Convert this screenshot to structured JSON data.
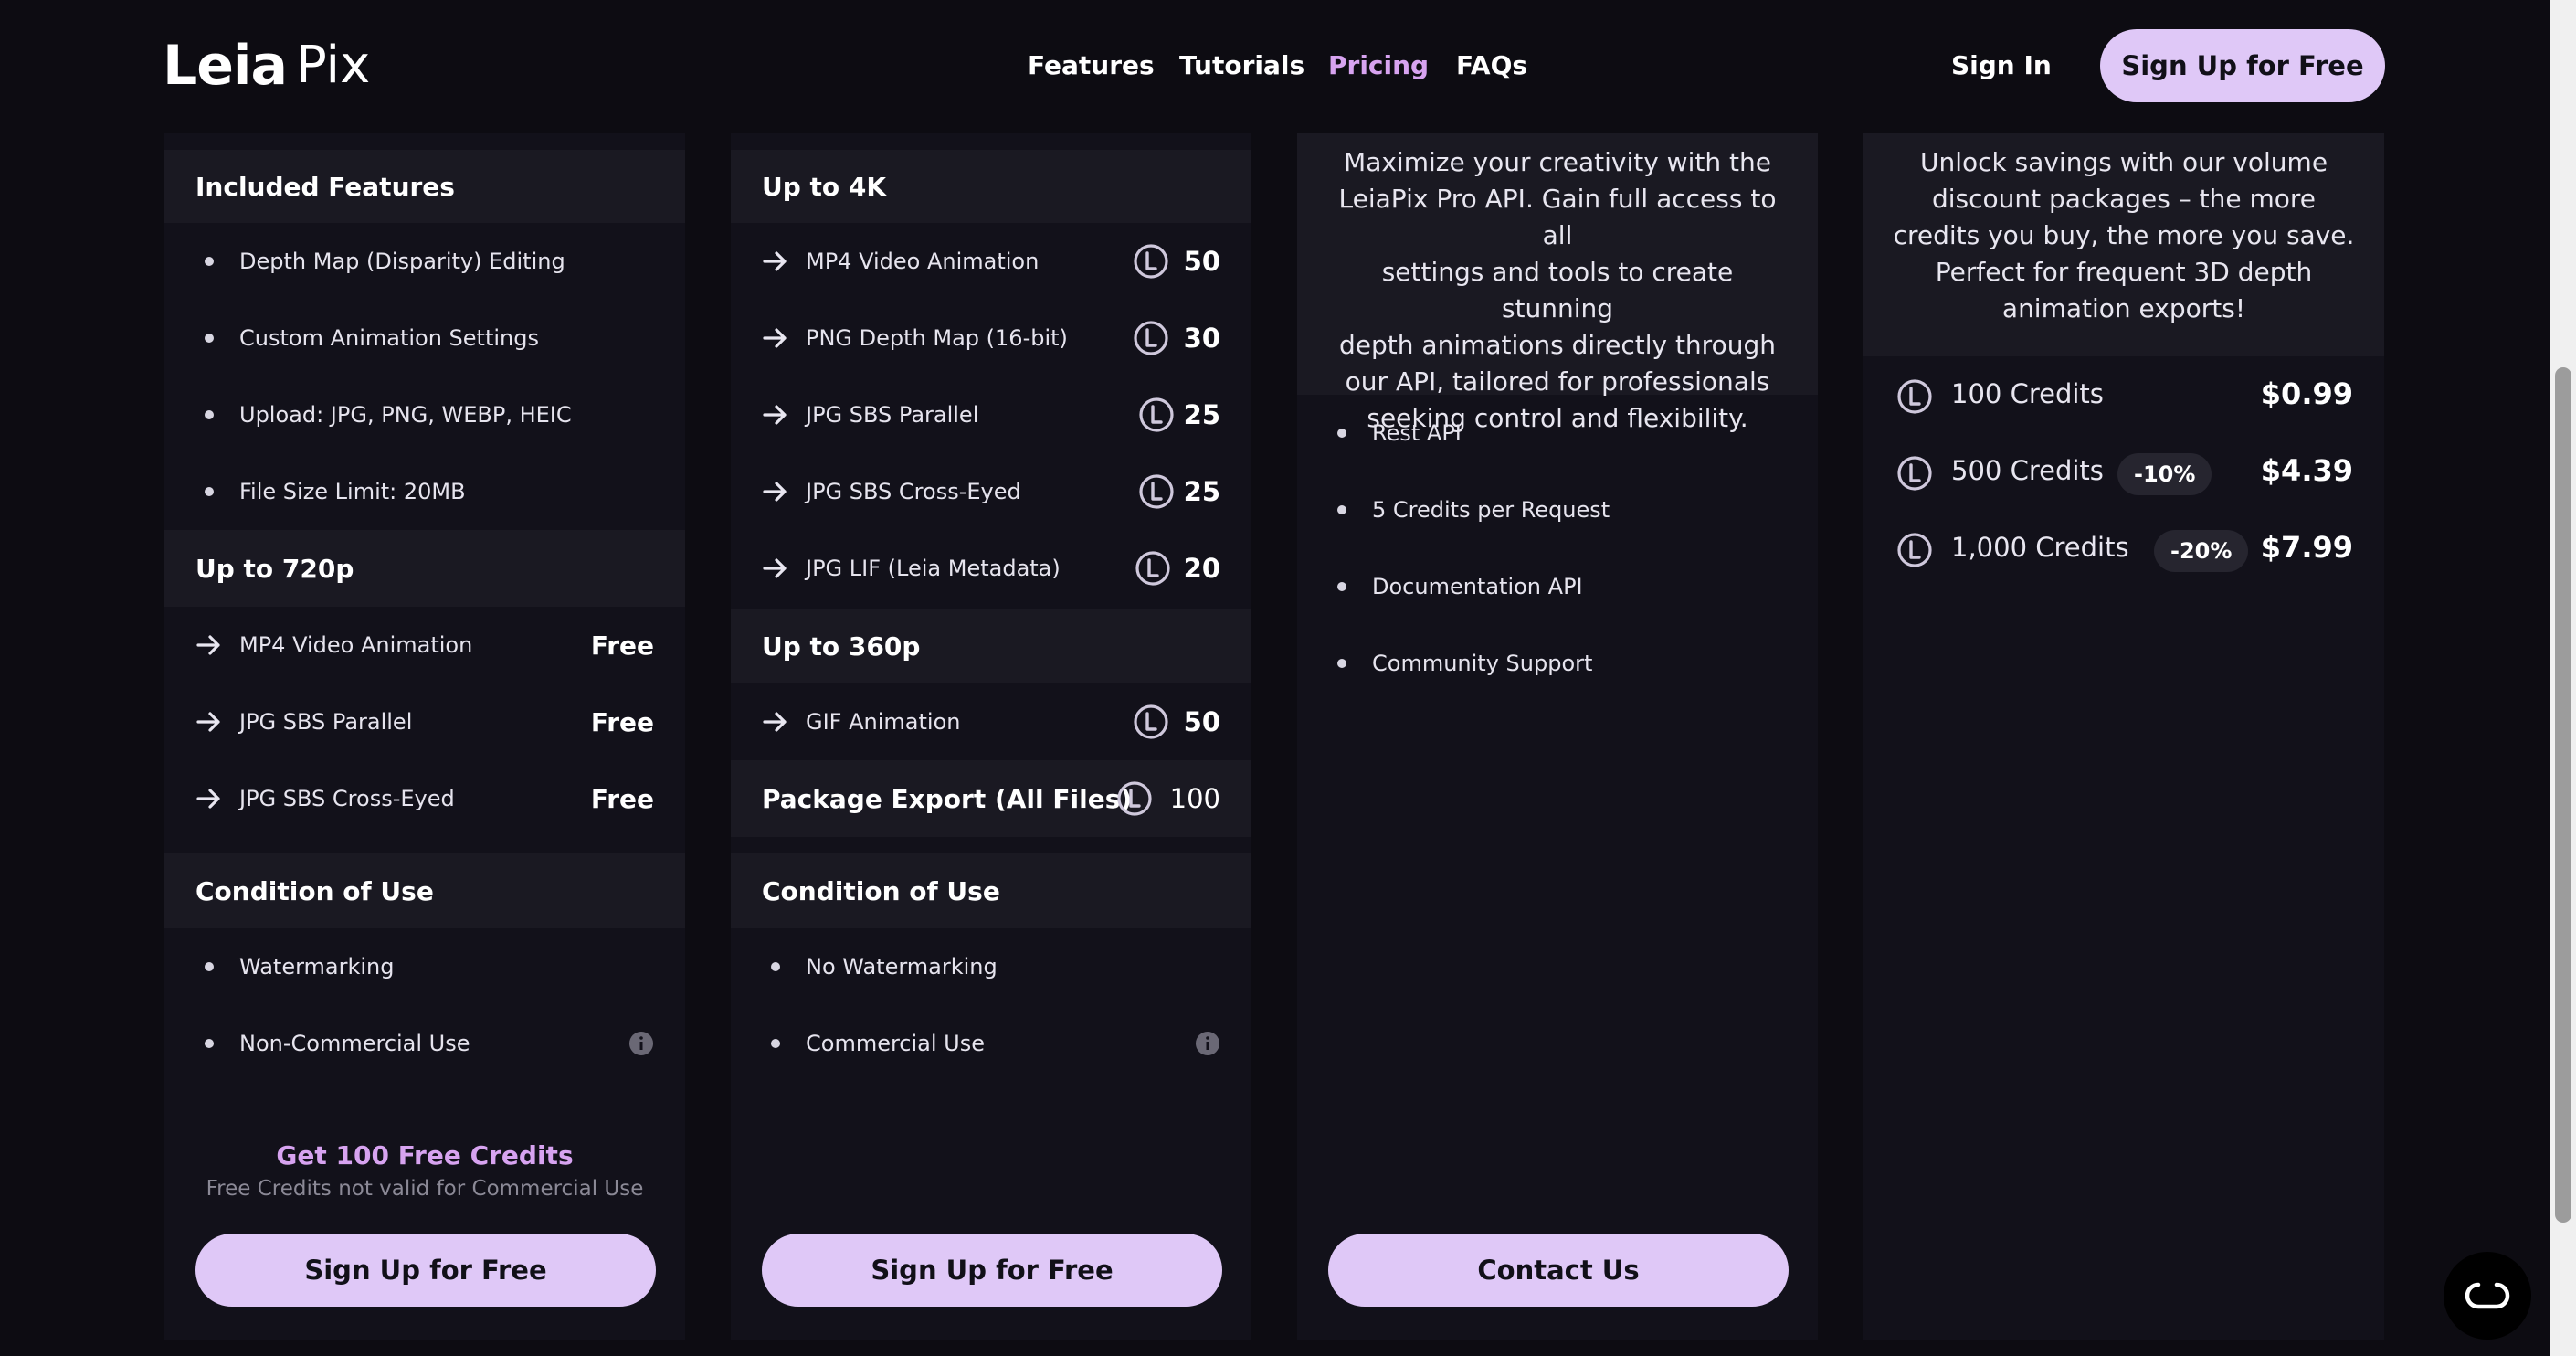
{
  "header": {
    "logo_leia": "Leia",
    "logo_pix": "Pix",
    "nav": [
      "Features",
      "Tutorials",
      "Pricing",
      "FAQs"
    ],
    "active_nav": "Pricing",
    "sign_in": "Sign In",
    "cta": "Sign Up for Free"
  },
  "free_card": {
    "included_title": "Included Features",
    "included": [
      "Depth Map (Disparity) Editing",
      "Custom Animation Settings",
      "Upload: JPG, PNG, WEBP, HEIC",
      "File Size Limit: 20MB"
    ],
    "res_title": "Up to 720p",
    "exports": [
      {
        "label": "MP4 Video Animation",
        "value": "Free"
      },
      {
        "label": "JPG SBS Parallel",
        "value": "Free"
      },
      {
        "label": "JPG SBS Cross-Eyed",
        "value": "Free"
      }
    ],
    "condition_title": "Condition of Use",
    "conditions": [
      "Watermarking",
      "Non-Commercial Use"
    ],
    "promo_title": "Get 100 Free Credits",
    "promo_sub": "Free Credits not valid for Commercial Use",
    "button": "Sign Up for Free"
  },
  "credits_card": {
    "res4k_title": "Up to 4K",
    "exports_4k": [
      {
        "label": "MP4 Video Animation",
        "credits": "50"
      },
      {
        "label": "PNG Depth Map (16-bit)",
        "credits": "30"
      },
      {
        "label": "JPG SBS Parallel",
        "credits": "25"
      },
      {
        "label": "JPG SBS Cross-Eyed",
        "credits": "25"
      },
      {
        "label": "JPG LIF (Leia Metadata)",
        "credits": "20"
      }
    ],
    "res360_title": "Up to 360p",
    "exports_360": [
      {
        "label": "GIF Animation",
        "credits": "50"
      }
    ],
    "package_label": "Package Export (All Files)",
    "package_credits": "100",
    "condition_title": "Condition of Use",
    "conditions": [
      "No Watermarking",
      "Commercial Use"
    ],
    "button": "Sign Up for Free"
  },
  "api_card": {
    "description_lines": [
      "Maximize your creativity with the",
      "LeiaPix Pro API. Gain full access to all",
      "settings and tools to create stunning",
      "depth animations directly through",
      "our API, tailored for professionals",
      "seeking  control and flexibility."
    ],
    "features": [
      "Rest API",
      "5 Credits per Request",
      "Documentation API",
      "Community Support"
    ],
    "button": "Contact Us"
  },
  "packages_card": {
    "description_lines": [
      "Unlock savings with our volume",
      "discount packages – the more",
      "credits you buy, the more you save.",
      "Perfect for frequent 3D depth",
      "animation exports!"
    ],
    "packages": [
      {
        "name": "100 Credits",
        "discount": "",
        "price": "$0.99"
      },
      {
        "name": "500 Credits",
        "discount": "-10%",
        "price": "$4.39"
      },
      {
        "name": "1,000 Credits",
        "discount": "-20%",
        "price": "$7.99"
      }
    ]
  },
  "icons": {
    "credit": "credit-coin-icon",
    "arrow": "arrow-right-icon",
    "info": "info-icon",
    "chat": "chat-widget-icon"
  },
  "colors": {
    "background": "#0d0c12",
    "card": "#12111a",
    "section_bar": "#1a1922",
    "accent": "#dfc8f7",
    "active_link": "#d7a3f0"
  }
}
